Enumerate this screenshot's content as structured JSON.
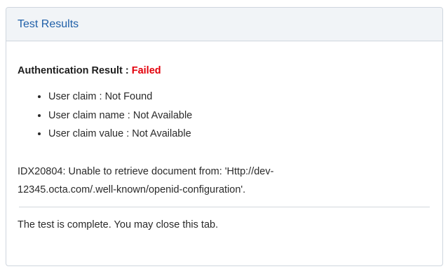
{
  "panel": {
    "title": "Test Results"
  },
  "result": {
    "label": "Authentication Result :",
    "status": "Failed",
    "status_color": "#e3000b"
  },
  "claims": [
    "User claim : Not Found",
    "User claim name : Not Available",
    "User claim value : Not Available"
  ],
  "error_message": "IDX20804: Unable to retrieve document from: 'Http://dev-12345.octa.com/.well-known/openid-configuration'.",
  "footer_message": "The test is complete. You may close this tab.",
  "colors": {
    "title": "#1f5fa8",
    "header_bg": "#f1f4f7",
    "border": "#cfd6de"
  }
}
